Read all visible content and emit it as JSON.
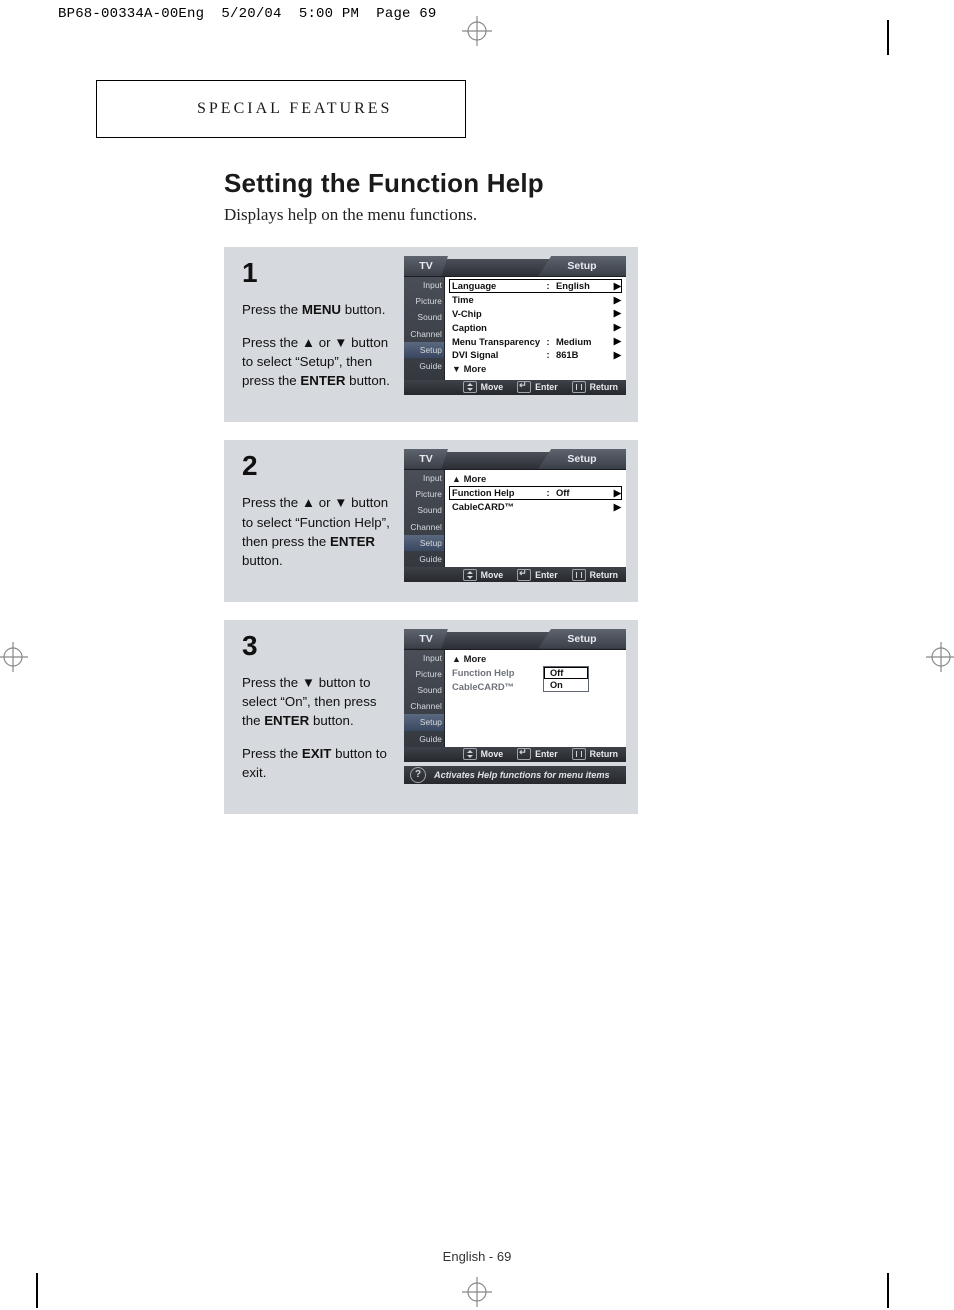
{
  "slug": "BP68-00334A-00Eng  5/20/04  5:00 PM  Page 69",
  "chapter": "SPECIAL FEATURES",
  "title": "Setting the Function Help",
  "lead": "Displays help on the menu functions.",
  "footer": "English - 69",
  "steps": {
    "s1": {
      "num": "1",
      "p1a": "Press the ",
      "p1b": "MENU",
      "p1c": " button.",
      "p2a": "Press the ",
      "p2b": "▲",
      "p2c": " or ",
      "p2d": "▼",
      "p2e": " button to select “Setup”, then press the ",
      "p2f": "ENTER",
      "p2g": " button."
    },
    "s2": {
      "num": "2",
      "p1a": "Press the ",
      "p1b": "▲",
      "p1c": " or ",
      "p1d": "▼",
      "p1e": " button to select “Function Help”, then press the ",
      "p1f": "ENTER",
      "p1g": " button."
    },
    "s3": {
      "num": "3",
      "p1a": "Press the ",
      "p1b": "▼",
      "p1c": " button to select “On”, then press the ",
      "p1d": "ENTER",
      "p1e": " button.",
      "p2a": "Press the ",
      "p2b": "EXIT",
      "p2c": " button to exit."
    }
  },
  "osd": {
    "tv": "TV",
    "setup": "Setup",
    "side": {
      "input": "Input",
      "picture": "Picture",
      "sound": "Sound",
      "channel": "Channel",
      "setup_tab": "Setup",
      "guide": "Guide"
    },
    "foot": {
      "move": "Move",
      "enter": "Enter",
      "return": "Return"
    },
    "step1": {
      "language": "Language",
      "language_val": "English",
      "time": "Time",
      "vchip": "V-Chip",
      "caption": "Caption",
      "menu_trans": "Menu Transparency",
      "menu_trans_val": "Medium",
      "dvi": "DVI Signal",
      "dvi_val": "861B",
      "more": "More"
    },
    "step2": {
      "more": "More",
      "fh": "Function Help",
      "fh_val": "Off",
      "cc": "CableCARD™"
    },
    "step3": {
      "more": "More",
      "fh": "Function Help",
      "cc": "CableCARD™",
      "opts": {
        "off": "Off",
        "on": "On"
      },
      "hint": "Activates Help functions for menu items"
    }
  }
}
